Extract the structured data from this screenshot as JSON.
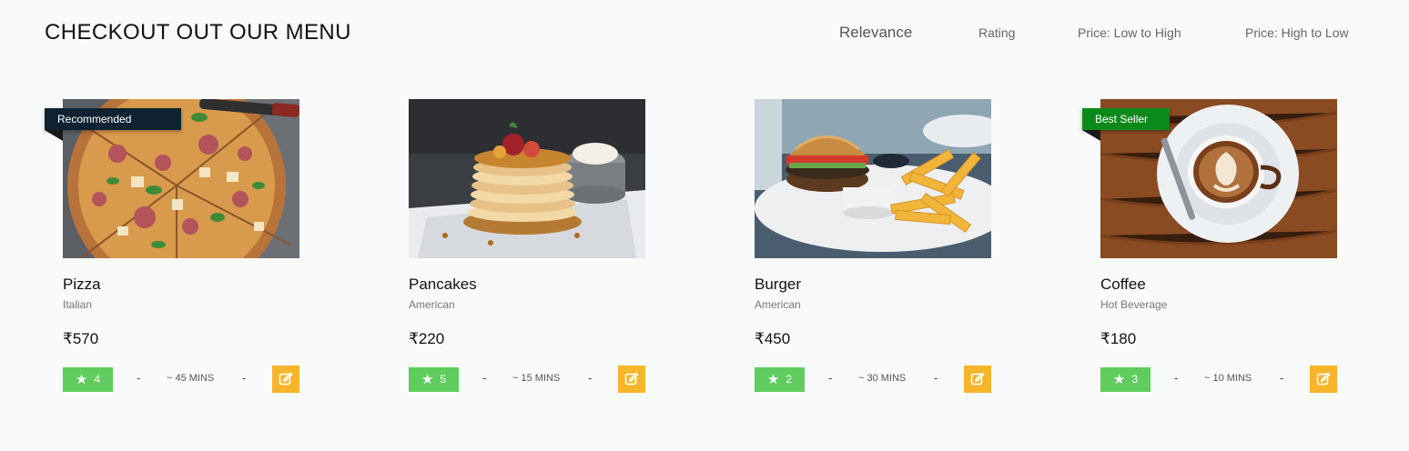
{
  "header": {
    "title": "CHECKOUT OUT OUR MENU"
  },
  "sort": {
    "options": [
      "Relevance",
      "Rating",
      "Price: Low to High",
      "Price: High to Low"
    ],
    "active": "Relevance"
  },
  "colors": {
    "rating_badge": "#60cc5f",
    "edit_button": "#f7b52c",
    "recommended_ribbon": "#0f2232",
    "bestseller_ribbon": "#0a8a1a"
  },
  "menu": [
    {
      "name": "Pizza",
      "cuisine": "Italian",
      "price": "₹570",
      "rating": "4",
      "eta": "~ 45 MINS",
      "badge": "Recommended",
      "image": "pizza"
    },
    {
      "name": "Pancakes",
      "cuisine": "American",
      "price": "₹220",
      "rating": "5",
      "eta": "~ 15 MINS",
      "badge": "",
      "image": "pancakes"
    },
    {
      "name": "Burger",
      "cuisine": "American",
      "price": "₹450",
      "rating": "2",
      "eta": "~ 30 MINS",
      "badge": "",
      "image": "burger"
    },
    {
      "name": "Coffee",
      "cuisine": "Hot Beverage",
      "price": "₹180",
      "rating": "3",
      "eta": "~ 10 MINS",
      "badge": "Best Seller",
      "image": "coffee"
    }
  ],
  "row": {
    "separator": "-",
    "star_icon": "star-icon",
    "edit_icon": "edit-icon"
  }
}
